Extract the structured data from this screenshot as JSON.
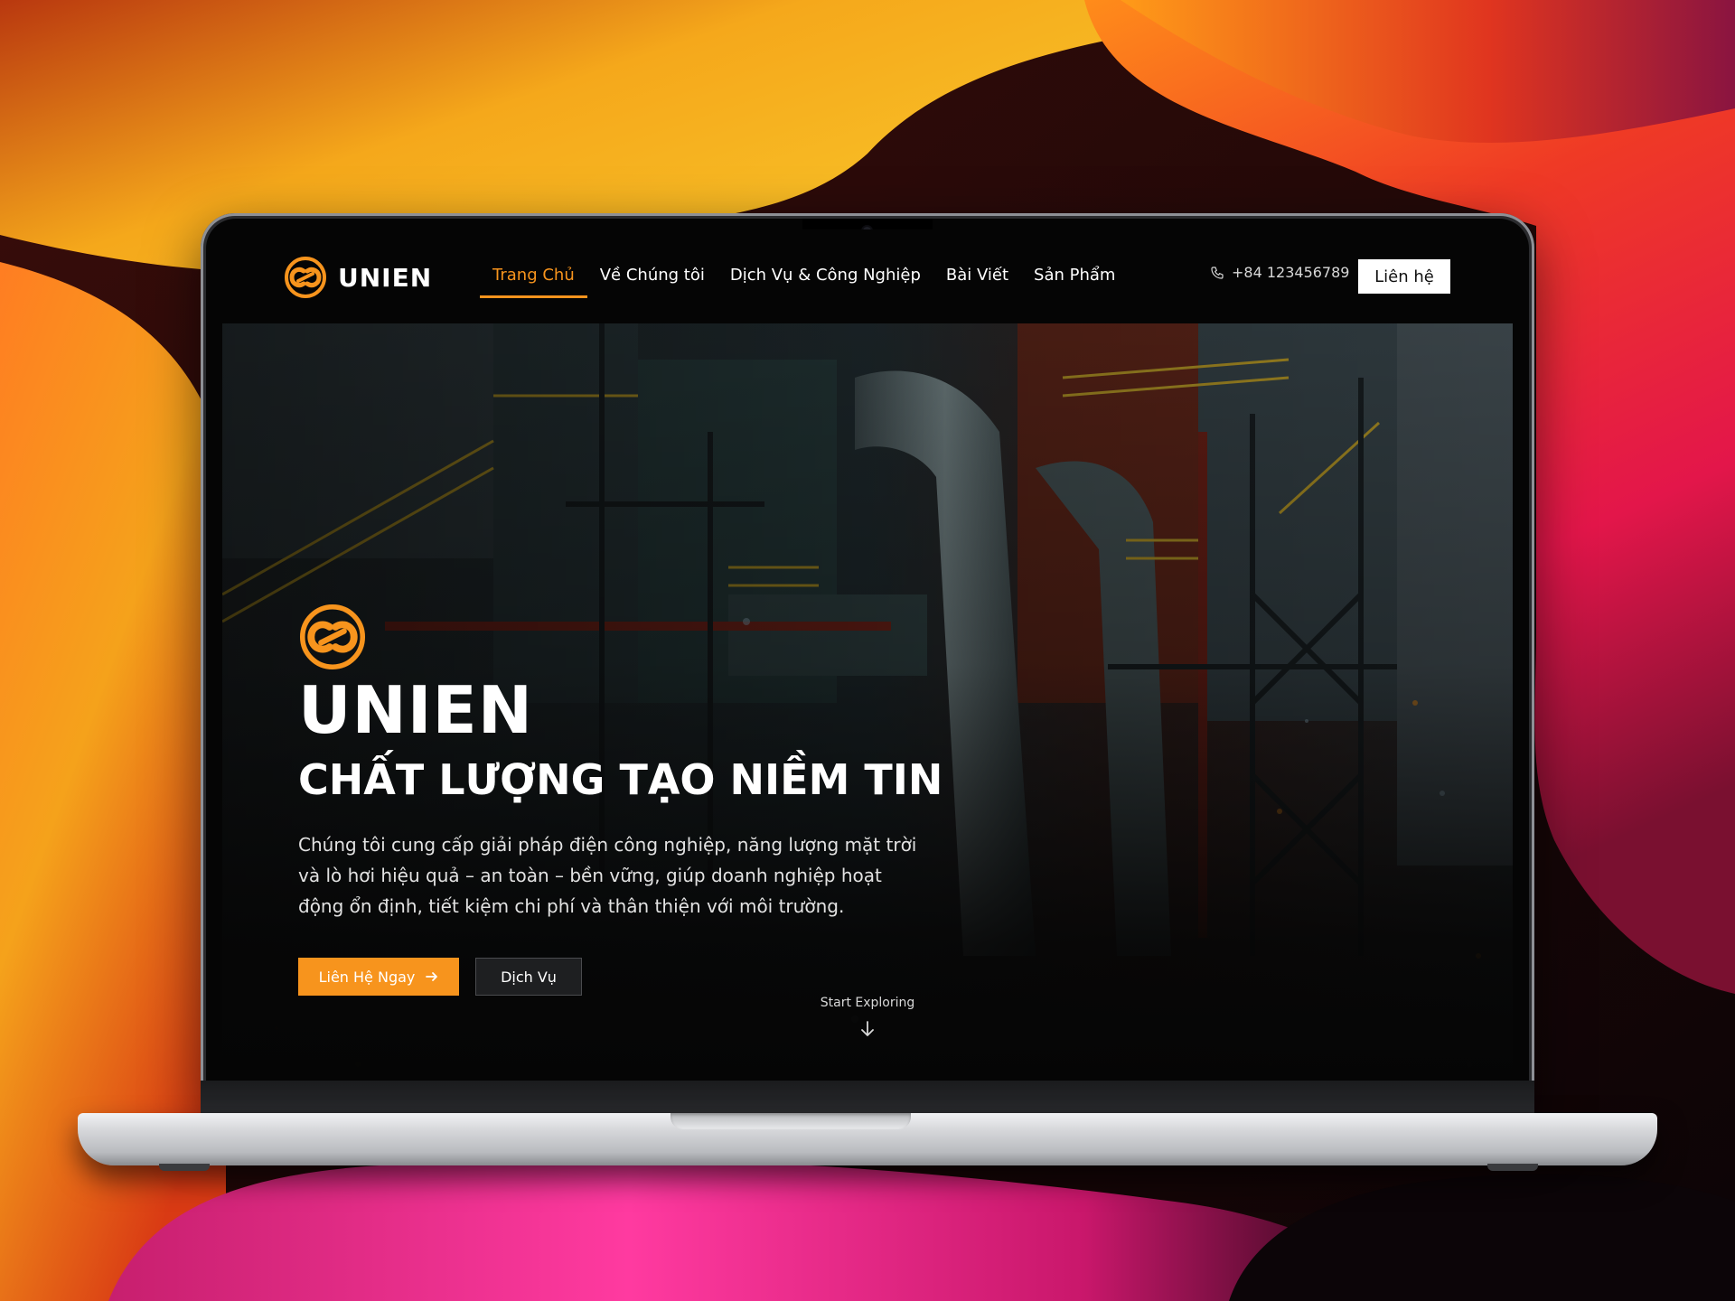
{
  "brand": {
    "name": "UNIEN",
    "accent_color": "#f7941d",
    "logo_icon": "linked-rings-logo-icon"
  },
  "nav": {
    "items": [
      {
        "label": "Trang Chủ",
        "active": true
      },
      {
        "label": "Về Chúng tôi",
        "active": false
      },
      {
        "label": "Dịch Vụ & Công Nghiệp",
        "active": false
      },
      {
        "label": "Bài Viết",
        "active": false
      },
      {
        "label": "Sản Phẩm",
        "active": false
      }
    ],
    "phone_icon": "phone-icon",
    "phone": "+84 123456789",
    "contact_label": "Liên hệ"
  },
  "hero": {
    "brand": "UNIEN",
    "tagline": "CHẤT LƯỢNG TẠO NIỀM TIN",
    "description": "Chúng tôi cung cấp giải pháp điện công nghiệp, năng lượng mặt trời và lò hơi hiệu quả – an toàn – bền vững, giúp doanh nghiệp hoạt động ổn định, tiết kiệm chi phí và thân thiện với môi trường.",
    "primary_button": "Liên Hệ Ngay",
    "primary_button_icon": "arrow-right-icon",
    "secondary_button": "Dịch Vụ",
    "explore_label": "Start Exploring",
    "explore_icon": "arrow-down-icon"
  },
  "colors": {
    "background": "#050505",
    "text": "#ffffff",
    "accent": "#f7941d"
  }
}
